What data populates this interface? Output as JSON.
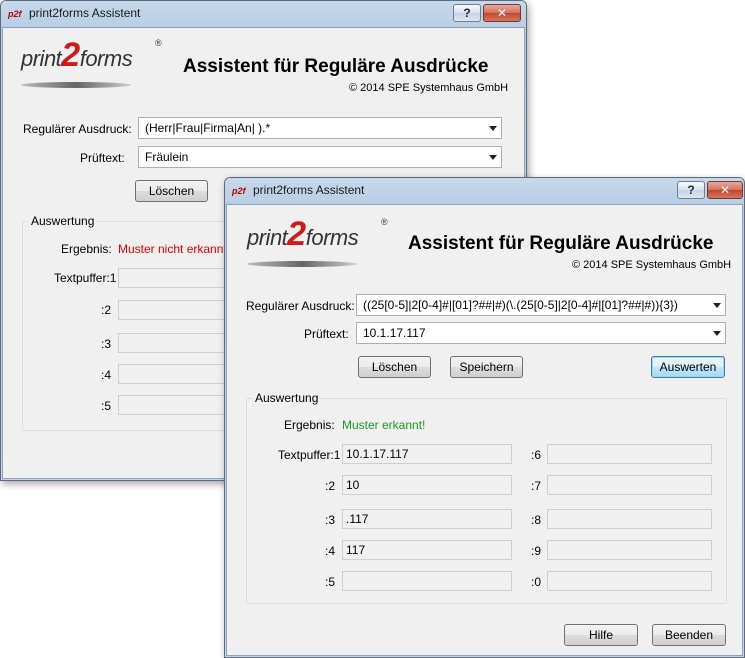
{
  "back_window": {
    "title": "print2forms Assistent",
    "title_buttons": {
      "help": "?",
      "close": "✕"
    },
    "logo": {
      "prefix": "print",
      "digit": "2",
      "suffix": "forms",
      "reg": "®"
    },
    "heading": "Assistent für Reguläre Ausdrücke",
    "copyright": "© 2014 SPE Systemhaus GmbH",
    "regex_label": "Regulärer Ausdruck:",
    "regex_value": "(Herr|Frau|Firma|An| ).*",
    "testtext_label": "Prüftext:",
    "testtext_value": "Fräulein",
    "clear_button": "Löschen",
    "group_title": "Auswertung",
    "result_label": "Ergebnis:",
    "result_value": "Muster nicht erkannt!",
    "buffer_labels": [
      "Textpuffer:1",
      ":2",
      ":3",
      ":4",
      ":5"
    ]
  },
  "front_window": {
    "title": "print2forms Assistent",
    "title_buttons": {
      "help": "?",
      "close": "✕"
    },
    "logo": {
      "prefix": "print",
      "digit": "2",
      "suffix": "forms",
      "reg": "®"
    },
    "heading": "Assistent für Reguläre Ausdrücke",
    "copyright": "© 2014 SPE Systemhaus GmbH",
    "regex_label": "Regulärer Ausdruck:",
    "regex_value": "((25[0-5]|2[0-4]#|[01]?##|#)(\\.(25[0-5]|2[0-4]#|[01]?##|#)){3})",
    "testtext_label": "Prüftext:",
    "testtext_value": "10.1.17.117",
    "buttons": {
      "clear": "Löschen",
      "save": "Speichern",
      "evaluate": "Auswerten",
      "help": "Hilfe",
      "quit": "Beenden"
    },
    "group_title": "Auswertung",
    "result_label": "Ergebnis:",
    "result_value": "Muster erkannt!",
    "buffers_left": [
      {
        "label": "Textpuffer:1",
        "value": "10.1.17.117"
      },
      {
        "label": ":2",
        "value": "10"
      },
      {
        "label": ":3",
        "value": ".117"
      },
      {
        "label": ":4",
        "value": "117"
      },
      {
        "label": ":5",
        "value": ""
      }
    ],
    "buffers_right": [
      {
        "label": ":6",
        "value": ""
      },
      {
        "label": ":7",
        "value": ""
      },
      {
        "label": ":8",
        "value": ""
      },
      {
        "label": ":9",
        "value": ""
      },
      {
        "label": ":0",
        "value": ""
      }
    ]
  },
  "colors": {
    "no_match": "#e00000",
    "match": "#1b9a1b",
    "logo_digit": "#d01818"
  }
}
